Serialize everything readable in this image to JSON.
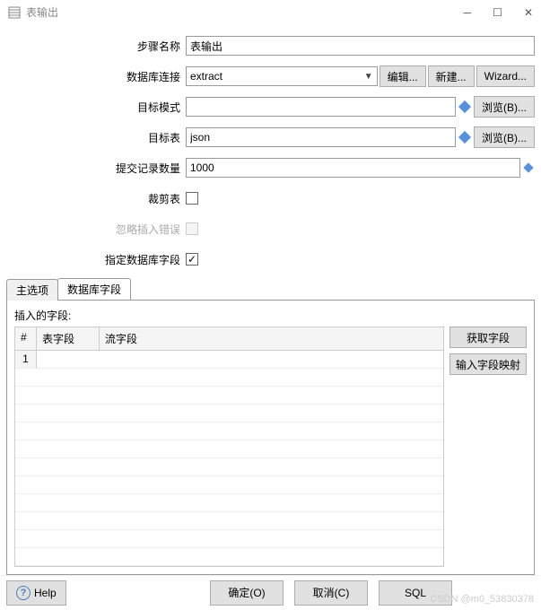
{
  "window": {
    "title": "表输出"
  },
  "form": {
    "step_name_label": "步骤名称",
    "step_name_value": "表输出",
    "db_conn_label": "数据库连接",
    "db_conn_value": "extract",
    "edit_btn": "编辑...",
    "new_btn": "新建...",
    "wizard_btn": "Wizard...",
    "target_schema_label": "目标模式",
    "target_schema_value": "",
    "browse1_btn": "浏览(B)...",
    "target_table_label": "目标表",
    "target_table_value": "json",
    "browse2_btn": "浏览(B)...",
    "commit_size_label": "提交记录数量",
    "commit_size_value": "1000",
    "truncate_label": "裁剪表",
    "truncate_checked": false,
    "ignore_err_label": "忽略插入错误",
    "ignore_err_checked": false,
    "specify_fields_label": "指定数据库字段",
    "specify_fields_checked": true
  },
  "tabs": {
    "main": "主选项",
    "db_fields": "数据库字段"
  },
  "fields_panel": {
    "title": "插入的字段:",
    "col_num": "#",
    "col_table_field": "表字段",
    "col_stream_field": "流字段",
    "rows": [
      {
        "num": "1",
        "table_field": "",
        "stream_field": ""
      }
    ],
    "get_fields_btn": "获取字段",
    "enter_mapping_btn": "输入字段映射"
  },
  "footer": {
    "help": "Help",
    "ok": "确定(O)",
    "cancel": "取消(C)",
    "sql": "SQL"
  },
  "watermark": "CSDN @m0_53830378"
}
